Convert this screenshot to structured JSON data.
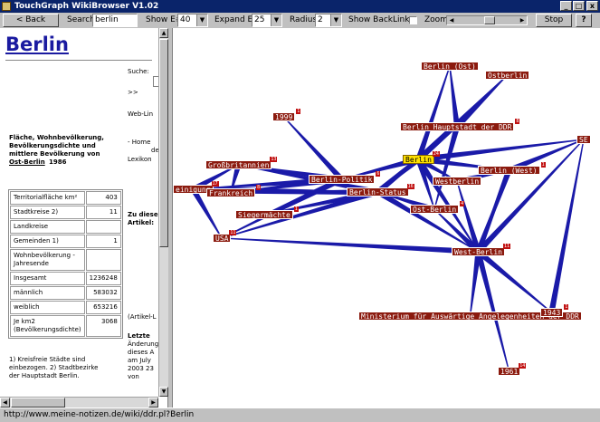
{
  "window": {
    "title": "TouchGraph WikiBrowser V1.02",
    "minimize_glyph": "_",
    "maximize_glyph": "□",
    "close_glyph": "x"
  },
  "toolbar": {
    "back_label": "< Back",
    "search_label": "Search",
    "search_value": "berlin",
    "show_label": "Show E#",
    "show_value": "40",
    "expand_label": "Expand E#",
    "expand_value": "25",
    "radius_label": "Radius",
    "radius_value": "2",
    "backlinks_label": "Show BackLinks",
    "backlinks_checked": false,
    "zoom_label": "Zoom",
    "zoom_level": 0.55,
    "stop_label": "Stop",
    "help_label": "?"
  },
  "webpage": {
    "title": "Berlin",
    "suche_label": "Suche:",
    "suche_go": ">>",
    "web_links": "Web-Lin",
    "home": "- Home",
    "de": "de",
    "lexikon": "Lexikon",
    "zu_dieser": "Zu diese",
    "artikel": "Artikel:",
    "artikel_l": "(Artikel-L",
    "caption_lines": [
      "Fläche, Wohnbevölkerung,",
      "Bevölkerungsdichte und",
      "mittlere Bevölkerung von"
    ],
    "caption_link": "Ost-Berlin",
    "caption_year": "1986",
    "table": [
      {
        "label": "Territorialfläche km²",
        "value": "403"
      },
      {
        "label": "Stadtkreise 2)",
        "value": "11"
      },
      {
        "label": "Landkreise",
        "value": ""
      },
      {
        "label": "Gemeinden 1)",
        "value": "1"
      },
      {
        "label": "Wohnbevölkerung - Jahresende",
        "value": ""
      },
      {
        "label": "Insgesamt",
        "value": "1236248"
      },
      {
        "label": "männlich",
        "value": "583032"
      },
      {
        "label": "weiblich",
        "value": "653216"
      },
      {
        "label": "Je km2 (Bevölkerungsdichte)",
        "value": "3068"
      }
    ],
    "footnote_lines": [
      "1) Kreisfreie Städte sind",
      "einbezogen. 2) Stadtbezirke",
      "der Hauptstadt Berlin."
    ],
    "letzte_lines": [
      "Letzte",
      "Änderung",
      "dieses A",
      "am July",
      "2003 23",
      "von"
    ]
  },
  "graph": {
    "edge_color": "#1a1aa8",
    "node_color": "#8b1a0e",
    "selected_color": "#ffe000",
    "nodes": [
      {
        "id": "berlin_ost",
        "label": "Berlin (Ost)",
        "count": ""
      },
      {
        "id": "ostberlin",
        "label": "Ostberlin",
        "count": ""
      },
      {
        "id": "y1999",
        "label": "1999",
        "count": "1"
      },
      {
        "id": "hauptstadt",
        "label": "Berlin Hauptstadt der DDR",
        "count": "8"
      },
      {
        "id": "se",
        "label": "SE",
        "count": ""
      },
      {
        "id": "gb",
        "label": "Großbritannien",
        "count": "13"
      },
      {
        "id": "berlin",
        "label": "Berlin",
        "count": "24"
      },
      {
        "id": "berlin_west",
        "label": "Berlin (West)",
        "count": "1"
      },
      {
        "id": "politik",
        "label": "Berlin-Politik",
        "count": "6"
      },
      {
        "id": "westberlin",
        "label": "Westberlin",
        "count": ""
      },
      {
        "id": "einigung",
        "label": "einigung",
        "count": "17"
      },
      {
        "id": "frankreich",
        "label": "Frankreich",
        "count": "8"
      },
      {
        "id": "status",
        "label": "Berlin-Status",
        "count": "16"
      },
      {
        "id": "siegermaechte",
        "label": "Siegermächte",
        "count": "1"
      },
      {
        "id": "ost_berlin",
        "label": "Ost-Berlin",
        "count": "4"
      },
      {
        "id": "usa",
        "label": "USA",
        "count": "11"
      },
      {
        "id": "west_berlin",
        "label": "West-Berlin",
        "count": "11"
      },
      {
        "id": "ministerium",
        "label": "Ministerium für Auswärtige Angelegenheiten der DDR",
        "count": ""
      },
      {
        "id": "y1943",
        "label": "1943",
        "count": "1"
      },
      {
        "id": "y1961",
        "label": "1961",
        "count": "14"
      }
    ],
    "edges": [
      [
        "berlin",
        "berlin_ost"
      ],
      [
        "berlin",
        "ostberlin"
      ],
      [
        "berlin",
        "hauptstadt"
      ],
      [
        "berlin",
        "berlin_west"
      ],
      [
        "berlin",
        "westberlin"
      ],
      [
        "berlin",
        "politik"
      ],
      [
        "berlin",
        "status"
      ],
      [
        "berlin",
        "ost_berlin"
      ],
      [
        "berlin",
        "west_berlin"
      ],
      [
        "berlin",
        "se"
      ],
      [
        "politik",
        "y1999"
      ],
      [
        "politik",
        "gb"
      ],
      [
        "politik",
        "frankreich"
      ],
      [
        "politik",
        "siegermaechte"
      ],
      [
        "politik",
        "usa"
      ],
      [
        "politik",
        "einigung"
      ],
      [
        "status",
        "siegermaechte"
      ],
      [
        "status",
        "usa"
      ],
      [
        "status",
        "frankreich"
      ],
      [
        "status",
        "gb"
      ],
      [
        "status",
        "west_berlin"
      ],
      [
        "status",
        "hauptstadt"
      ],
      [
        "west_berlin",
        "ministerium"
      ],
      [
        "west_berlin",
        "y1943"
      ],
      [
        "west_berlin",
        "y1961"
      ],
      [
        "west_berlin",
        "ost_berlin"
      ],
      [
        "west_berlin",
        "westberlin"
      ],
      [
        "west_berlin",
        "berlin_west"
      ],
      [
        "west_berlin",
        "se"
      ],
      [
        "west_berlin",
        "usa"
      ],
      [
        "hauptstadt",
        "ost_berlin"
      ],
      [
        "hauptstadt",
        "berlin_ost"
      ],
      [
        "hauptstadt",
        "ostberlin"
      ],
      [
        "westberlin",
        "berlin_west"
      ],
      [
        "einigung",
        "gb"
      ],
      [
        "einigung",
        "usa"
      ],
      [
        "einigung",
        "status"
      ],
      [
        "ost_berlin",
        "status"
      ],
      [
        "berlin_west",
        "west_berlin"
      ],
      [
        "gb",
        "frankreich"
      ],
      [
        "berlin_west",
        "se"
      ],
      [
        "y1943",
        "se"
      ]
    ]
  },
  "status": {
    "url": "http://www.meine-notizen.de/wiki/ddr.pl?Berlin"
  }
}
